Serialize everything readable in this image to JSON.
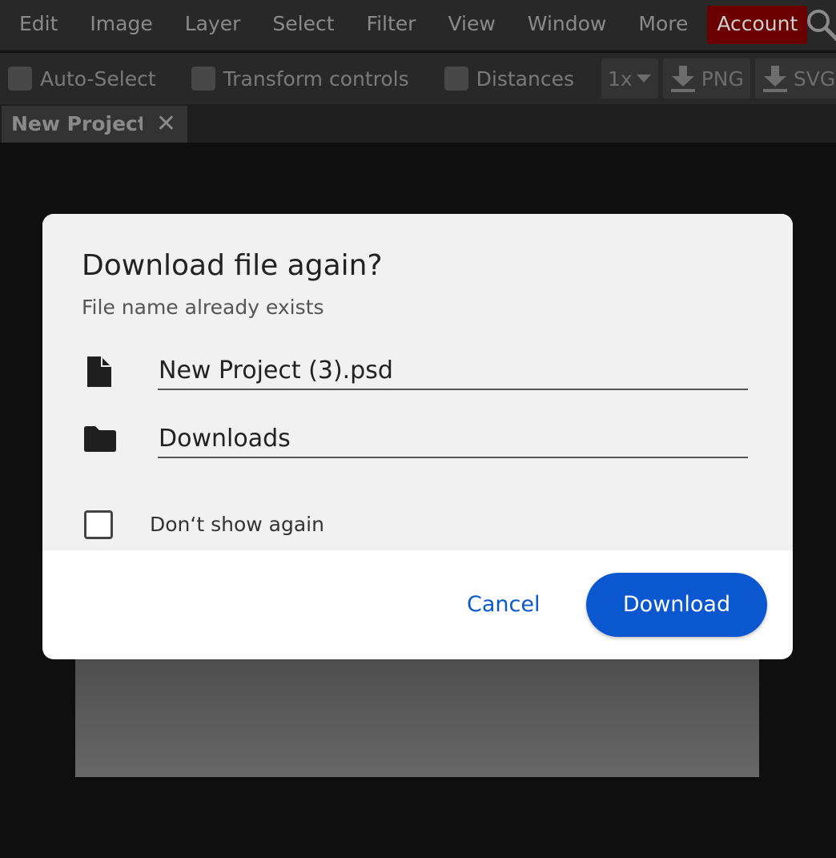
{
  "menu": {
    "items": [
      "Edit",
      "Image",
      "Layer",
      "Select",
      "Filter",
      "View",
      "Window",
      "More"
    ],
    "account_label": "Account"
  },
  "toolbar": {
    "auto_select": "Auto-Select",
    "transform_controls": "Transform controls",
    "distances": "Distances",
    "scale": "1x",
    "png_label": "PNG",
    "svg_label": "SVG"
  },
  "tabs": [
    {
      "label": "New Project"
    }
  ],
  "dialog": {
    "title": "Download file again?",
    "subtitle": "File name already exists",
    "file_name": "New Project (3).psd",
    "folder": "Downloads",
    "dont_show_label": "Don‘t show again",
    "cancel_label": "Cancel",
    "download_label": "Download"
  },
  "colors": {
    "accent": "#0b57d0",
    "account_bg": "#6b0000",
    "menubar_bg": "#282828"
  }
}
